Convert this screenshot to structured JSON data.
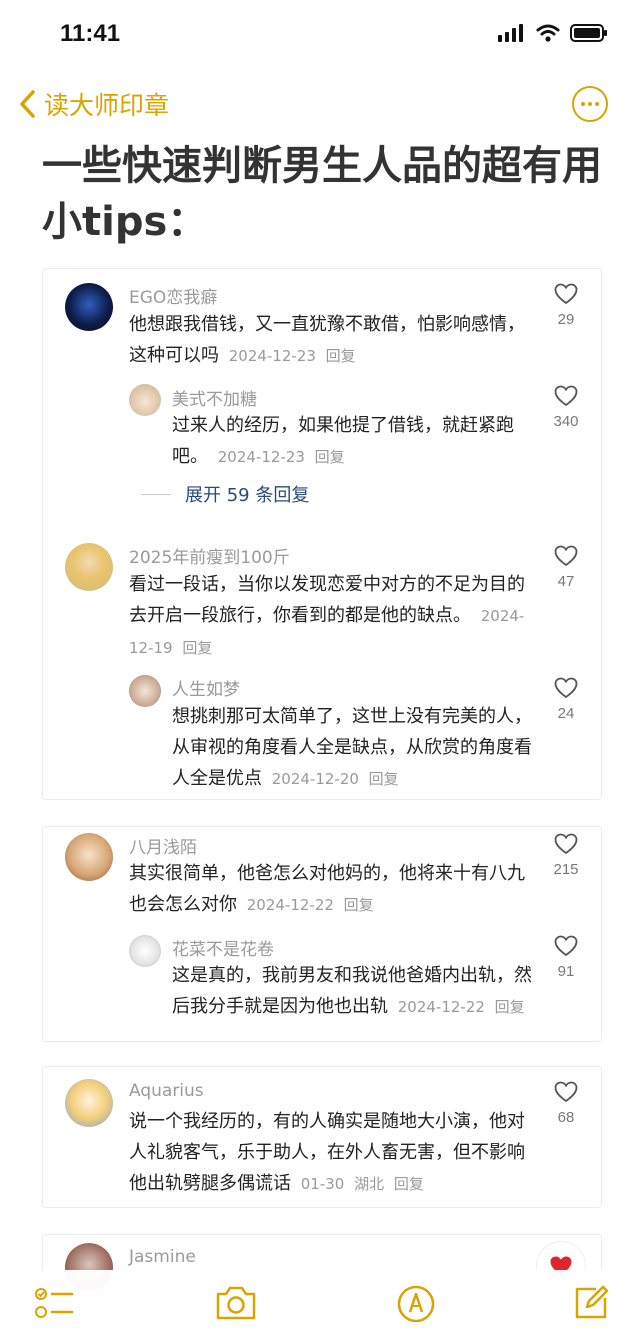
{
  "status": {
    "time": "11:41"
  },
  "nav": {
    "back_label": "读大师印章"
  },
  "title": "一些快速判断男生人品的超有用小tips：",
  "comments": [
    {
      "user": "EGO恋我癖",
      "text": "他想跟我借钱，又一直犹豫不敢借，怕影响感情，这种可以吗",
      "date": "2024-12-23",
      "reply_label": "回复",
      "likes": "29",
      "replies": [
        {
          "user": "美式不加糖",
          "text": "过来人的经历，如果他提了借钱，就赶紧跑吧。",
          "date": "2024-12-23",
          "reply_label": "回复",
          "likes": "340"
        }
      ],
      "expand_label": "展开 59 条回复"
    },
    {
      "user": "2025年前瘦到100斤",
      "text": "看过一段话，当你以发现恋爱中对方的不足为目的去开启一段旅行，你看到的都是他的缺点。",
      "date": "2024-12-19",
      "reply_label": "回复",
      "likes": "47",
      "replies": [
        {
          "user": "人生如梦",
          "text": "想挑刺那可太简单了，这世上没有完美的人，从审视的角度看人全是缺点，从欣赏的角度看人全是优点",
          "date": "2024-12-20",
          "reply_label": "回复",
          "likes": "24"
        }
      ]
    },
    {
      "user": "八月浅陌",
      "text": "其实很简单，他爸怎么对他妈的，他将来十有八九也会怎么对你",
      "date": "2024-12-22",
      "reply_label": "回复",
      "likes": "215",
      "replies": [
        {
          "user": "花菜不是花卷",
          "text": "这是真的，我前男友和我说他爸婚内出轨，然后我分手就是因为他也出轨",
          "date": "2024-12-22",
          "reply_label": "回复",
          "likes": "91"
        }
      ]
    },
    {
      "user": "Aquarius",
      "text": "说一个我经历的，有的人确实是随地大小演，他对人礼貌客气，乐于助人，在外人畜无害，但不影响他出轨劈腿多偶谎话",
      "date": "01-30",
      "location": "湖北",
      "reply_label": "回复",
      "likes": "68"
    },
    {
      "user": "Jasmine"
    }
  ],
  "colors": {
    "accent": "#d9a300",
    "link": "#2a4a7c",
    "muted": "#9a9a9a"
  }
}
